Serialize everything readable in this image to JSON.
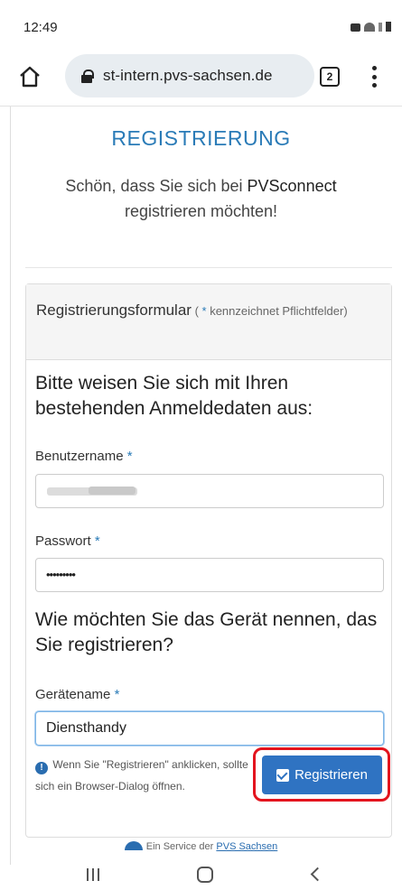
{
  "status_bar": {
    "time": "12:49"
  },
  "browser": {
    "url": "st-intern.pvs-sachsen.de",
    "tab_count": "2"
  },
  "page": {
    "title": "REGISTRIERUNG",
    "welcome_pre": "Schön, dass Sie sich bei ",
    "welcome_brand": "PVSconnect",
    "welcome_post": " registrieren möchten!"
  },
  "form": {
    "heading": "Registrierungsformular",
    "heading_note_open": " ( ",
    "required_mark": "*",
    "heading_note": " kennzeichnet Pflichtfelder)",
    "login_prompt": "Bitte weisen Sie sich mit Ihren bestehenden Anmeldedaten aus:",
    "username_label": "Benutzername",
    "password_label": "Passwort",
    "password_value": "•••••••••",
    "device_prompt": "Wie möchten Sie das Gerät nennen, das Sie registrieren?",
    "device_label": "Gerätename",
    "device_value": "Diensthandy",
    "info_icon": "!",
    "info_text": "Wenn Sie \"Registrieren\" anklicken, sollte sich ein Browser-Dialog öffnen.",
    "submit_label": "Registrieren",
    "highlight_color": "#e3141e",
    "accent_color": "#2a7bb7"
  },
  "footer": {
    "text": "Ein Service der ",
    "link": "PVS Sachsen"
  },
  "icons": [
    "home-icon",
    "lock-icon",
    "tabs-icon",
    "overflow-menu-icon",
    "info-icon",
    "checkbox-icon",
    "pvs-logo-icon",
    "recent-apps-icon",
    "home-nav-icon",
    "back-icon"
  ]
}
